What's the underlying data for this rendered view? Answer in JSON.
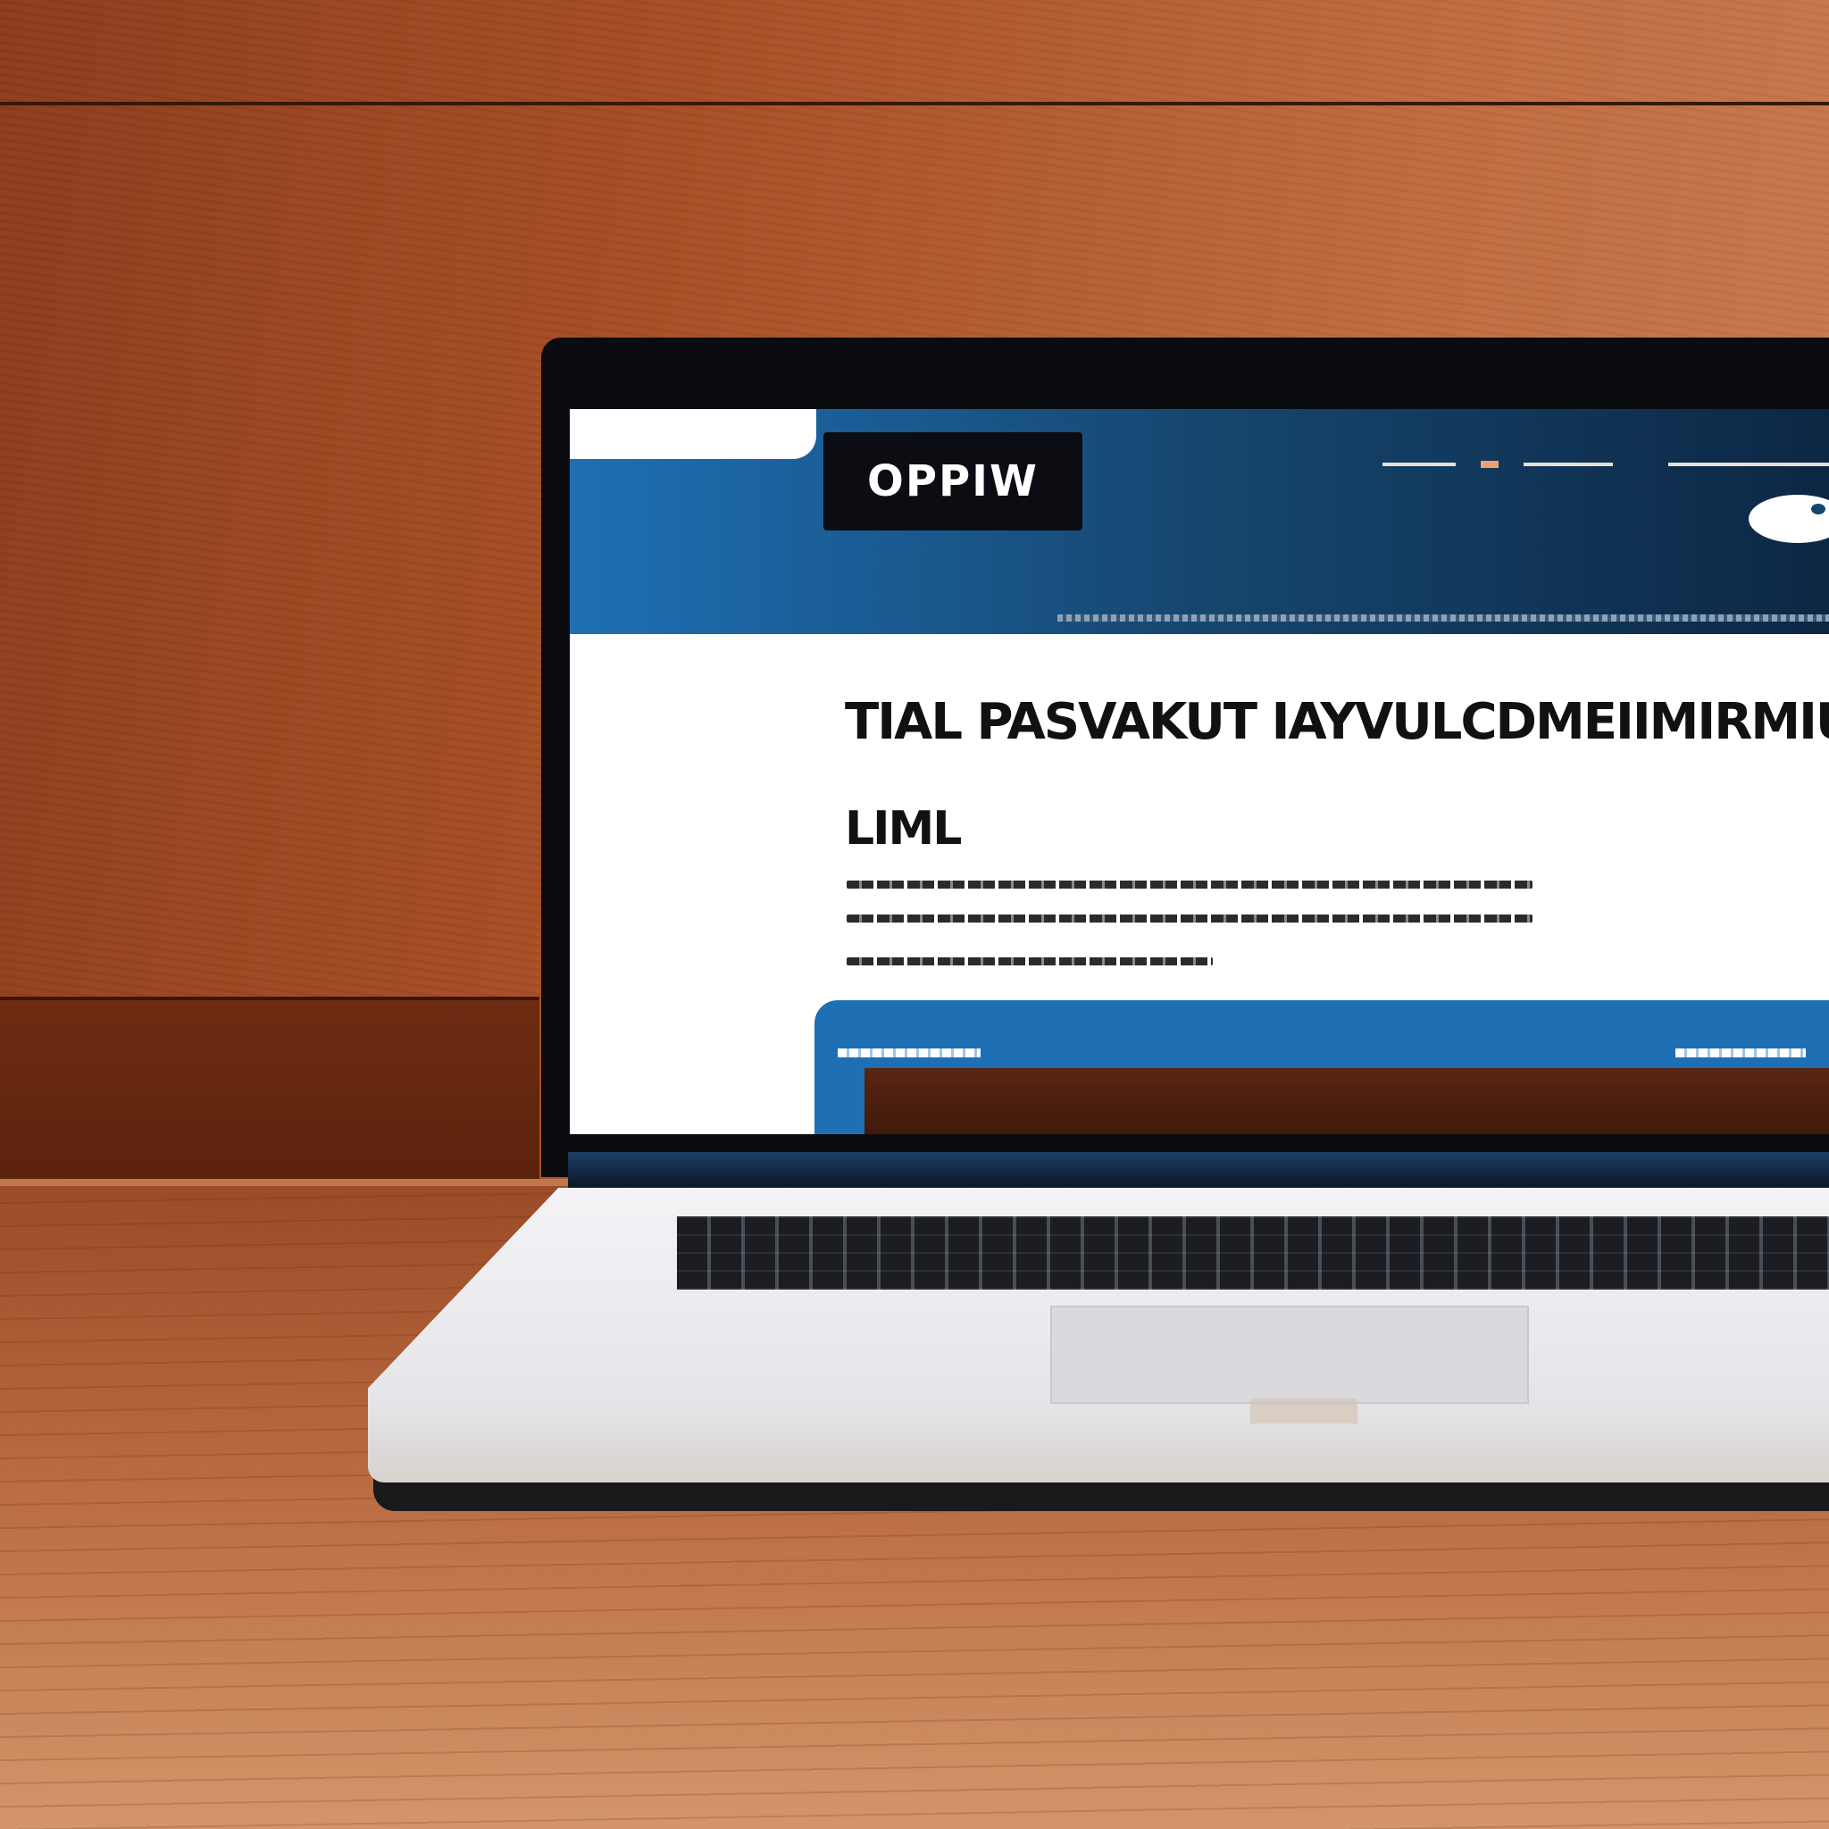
{
  "screen": {
    "logo_text": "OPPIW",
    "headline_line1": "TIAL PASVAKUT IAYVULCDMEIIMIRMIUMIS LAIEL",
    "headline_line2": "LIML"
  },
  "colors": {
    "wall": "#a84e25",
    "table": "#b96a40",
    "hero_blue": "#1e6fb4",
    "hero_navy": "#0c2744",
    "panel_blue": "#1f6fb5",
    "laptop_silver": "#e9e9ed"
  },
  "icons": {
    "pill_shape": "oval-icon"
  }
}
